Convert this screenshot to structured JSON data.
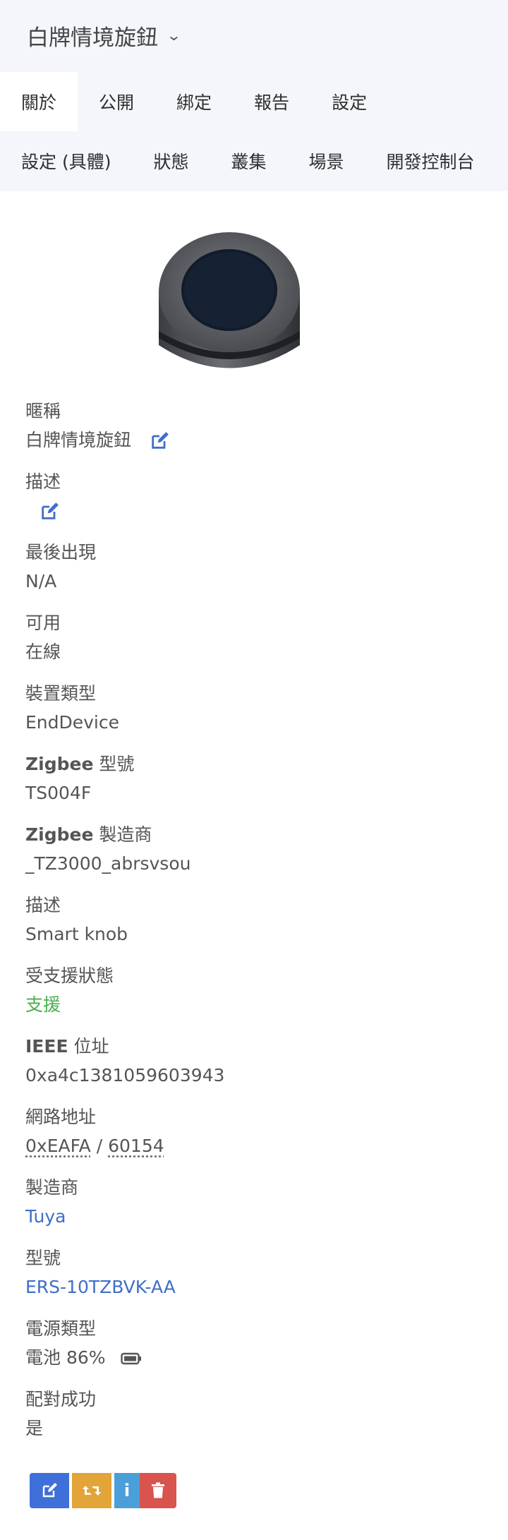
{
  "header": {
    "title": "白牌情境旋鈕",
    "chevron_icon": "chevron-down-icon"
  },
  "tabs_row1": [
    {
      "label": "關於",
      "active": true
    },
    {
      "label": "公開"
    },
    {
      "label": "綁定"
    },
    {
      "label": "報告"
    },
    {
      "label": "設定"
    }
  ],
  "tabs_row2": [
    {
      "label": "設定 (具體)"
    },
    {
      "label": "狀態"
    },
    {
      "label": "叢集"
    },
    {
      "label": "場景"
    },
    {
      "label": "開發控制台"
    }
  ],
  "fields": {
    "nickname": {
      "label": "暱稱",
      "value": "白牌情境旋鈕"
    },
    "description_edit": {
      "label": "描述"
    },
    "last_seen": {
      "label": "最後出現",
      "value": "N/A"
    },
    "availability": {
      "label": "可用",
      "value": "在線"
    },
    "device_type": {
      "label": "裝置類型",
      "value": "EndDevice"
    },
    "zigbee_model": {
      "label_bold": "Zigbee",
      "label_rest": " 型號",
      "value": "TS004F"
    },
    "zigbee_manufacturer": {
      "label_bold": "Zigbee",
      "label_rest": " 製造商",
      "value": "_TZ3000_abrsvsou"
    },
    "description": {
      "label": "描述",
      "value": "Smart knob"
    },
    "support_status": {
      "label": "受支援狀態",
      "value": "支援"
    },
    "ieee": {
      "label_bold": "IEEE",
      "label_rest": " 位址",
      "value": "0xa4c1381059603943"
    },
    "network_address": {
      "label": "網路地址",
      "hex": "0xEAFA",
      "sep": " / ",
      "dec": "60154"
    },
    "manufacturer": {
      "label": "製造商",
      "value": "Tuya"
    },
    "model": {
      "label": "型號",
      "value": "ERS-10TZBVK-AA"
    },
    "power": {
      "label": "電源類型",
      "value": "電池 86%"
    },
    "interview": {
      "label": "配對成功",
      "value": "是"
    }
  },
  "colors": {
    "green": "#4caf50",
    "link": "#3f6fc8",
    "edit_btn": "#3f6fd9",
    "swap_btn": "#e3a438",
    "info_btn": "#4a9fd8",
    "delete_btn": "#d9534f"
  },
  "actions": {
    "info_label": "i"
  }
}
